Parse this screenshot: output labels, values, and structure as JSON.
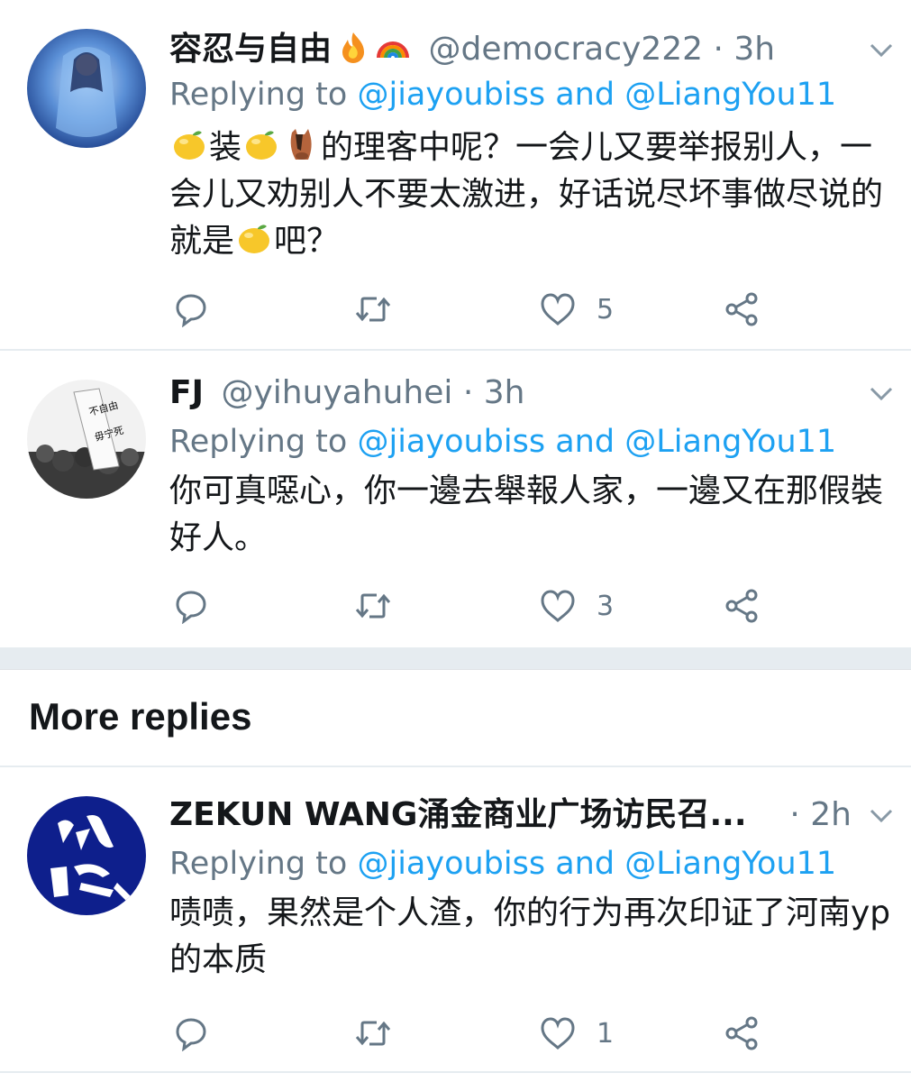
{
  "replies": [
    {
      "name": "容忍与自由",
      "handle": "@democracy222",
      "time": "3h",
      "replying_prefix": "Replying to",
      "replying_users": [
        "@jiayoubiss",
        "@LiangYou11"
      ],
      "replying_and": "and",
      "text_parts": [
        "装",
        "的理客中呢？一会儿又要举报别人，一会儿又劝别人不要太激进，好话说尽坏事做尽说的就是",
        "吧？"
      ],
      "like_count": "5",
      "emojis": [
        "lemon",
        "lemon",
        "horse",
        "lemon",
        "fire",
        "rainbow"
      ]
    },
    {
      "name": "FJ",
      "handle": "@yihuyahuhei",
      "time": "3h",
      "replying_prefix": "Replying to",
      "replying_users": [
        "@jiayoubiss",
        "@LiangYou11"
      ],
      "replying_and": "and",
      "text": "你可真噁心，你一邊去舉報人家，一邊又在那假裝好人。",
      "like_count": "3"
    },
    {
      "name": "ZEKUN WANG涌金商业广场访民召...",
      "time": "2h",
      "replying_prefix": "Replying to",
      "replying_users": [
        "@jiayoubiss",
        "@LiangYou11"
      ],
      "replying_and": "and",
      "text": "啧啧，果然是个人渣，你的行为再次印证了河南yp的本质",
      "like_count": "1"
    }
  ],
  "more_replies_label": "More replies",
  "colors": {
    "text": "#14171a",
    "secondary": "#657786",
    "link": "#1da1f2",
    "divider": "#e6ecf0"
  },
  "icons": [
    "reply-icon",
    "retweet-icon",
    "like-icon",
    "share-icon",
    "chevron-down-icon"
  ]
}
